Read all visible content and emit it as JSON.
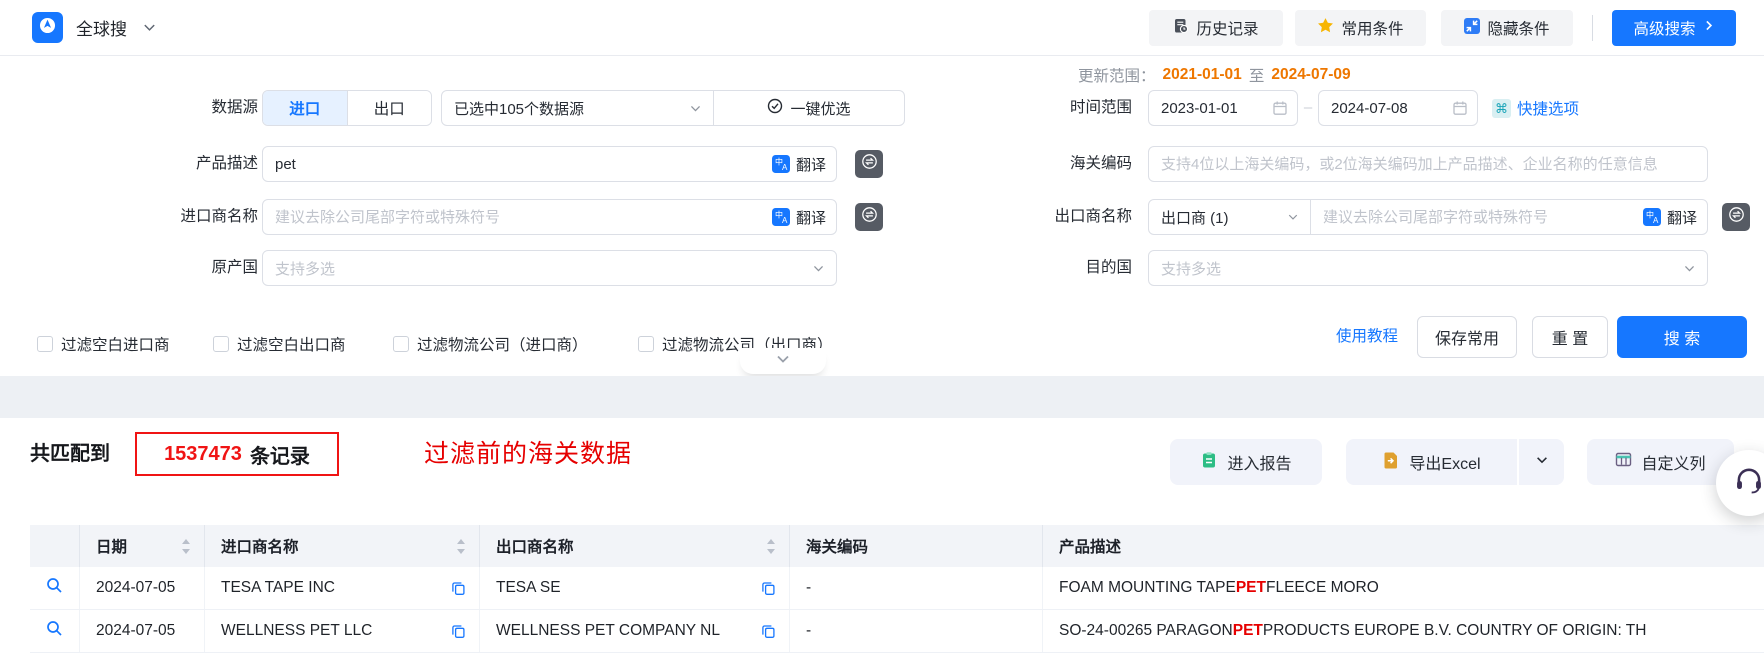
{
  "topbar": {
    "app_title": "全球搜",
    "history_label": "历史记录",
    "favorites_label": "常用条件",
    "hide_conditions_label": "隐藏条件",
    "advanced_search_label": "高级搜索"
  },
  "form": {
    "update_range": {
      "label": "更新范围：",
      "start": "2021-01-01",
      "conjunction": "至",
      "end": "2024-07-09"
    },
    "datasource": {
      "label": "数据源",
      "import_tab": "进口",
      "export_tab": "出口",
      "selected_summary": "已选中105个数据源",
      "optimize_label": "一键优选"
    },
    "time_range": {
      "label": "时间范围",
      "start_value": "2023-01-01",
      "separator": "–",
      "end_value": "2024-07-08",
      "quick_options_label": "快捷选项"
    },
    "product_desc": {
      "label": "产品描述",
      "value": "pet"
    },
    "hs_code": {
      "label": "海关编码",
      "placeholder": "支持4位以上海关编码，或2位海关编码加上产品描述、企业名称的任意信息"
    },
    "importer": {
      "label": "进口商名称",
      "placeholder": "建议去除公司尾部字符或特殊符号"
    },
    "exporter": {
      "label": "出口商名称",
      "type_value": "出口商 (1)",
      "placeholder": "建议去除公司尾部字符或特殊符号"
    },
    "origin_country": {
      "label": "原产国",
      "placeholder": "支持多选"
    },
    "dest_country": {
      "label": "目的国",
      "placeholder": "支持多选"
    },
    "translate_label": "翻译",
    "filters": [
      {
        "label": "过滤空白进口商",
        "checked": false
      },
      {
        "label": "过滤空白出口商",
        "checked": false
      },
      {
        "label": "过滤物流公司（进口商）",
        "checked": false
      },
      {
        "label": "过滤物流公司（出口商）",
        "checked": false
      }
    ],
    "tutorial_label": "使用教程",
    "save_label": "保存常用",
    "reset_label": "重 置",
    "search_label": "搜 索"
  },
  "results": {
    "match_prefix": "共匹配到",
    "match_count": "1537473",
    "match_unit": "条记录",
    "annotation": "过滤前的海关数据",
    "report_label": "进入报告",
    "export_label": "导出Excel",
    "custom_columns_label": "自定义列",
    "table": {
      "headers": [
        "日期",
        "进口商名称",
        "出口商名称",
        "海关编码",
        "产品描述"
      ],
      "rows": [
        {
          "date": "2024-07-05",
          "importer": "TESA TAPE INC",
          "exporter": "TESA SE",
          "hs_code": "-",
          "desc_pre": "FOAM MOUNTING TAPE ",
          "desc_keyword": "PET",
          "desc_post": " FLEECE MORO"
        },
        {
          "date": "2024-07-05",
          "importer": "WELLNESS PET LLC",
          "exporter": "WELLNESS PET COMPANY NL",
          "hs_code": "-",
          "desc_pre": "SO-24-00265 PARAGON ",
          "desc_keyword": "PET",
          "desc_post": " PRODUCTS EUROPE B.V. COUNTRY OF ORIGIN: TH"
        }
      ]
    }
  },
  "colors": {
    "primary": "#1677ff",
    "update_orange": "#ee7700",
    "highlight_red": "#e60000",
    "star_yellow": "#f7b500",
    "toggle_active_bg": "#e6f1ff",
    "button_gray_bg": "#f3f4f6",
    "results_button_bg": "#f1f3fa",
    "table_header_bg": "#f2f4f8"
  },
  "icons": {
    "logo": "compass-globe",
    "history": "document-clock",
    "favorites": "star",
    "hide": "collapse-arrows",
    "optimize": "check-circle",
    "date": "calendar",
    "quick": "command-key",
    "translate": "zh-to-en-square",
    "swap": "swap-arrows-circle",
    "report": "clipboard",
    "export": "document-arrow",
    "custom_columns": "table-columns",
    "support": "headset",
    "row_action": "magnifier",
    "copy": "copy-sheets"
  }
}
